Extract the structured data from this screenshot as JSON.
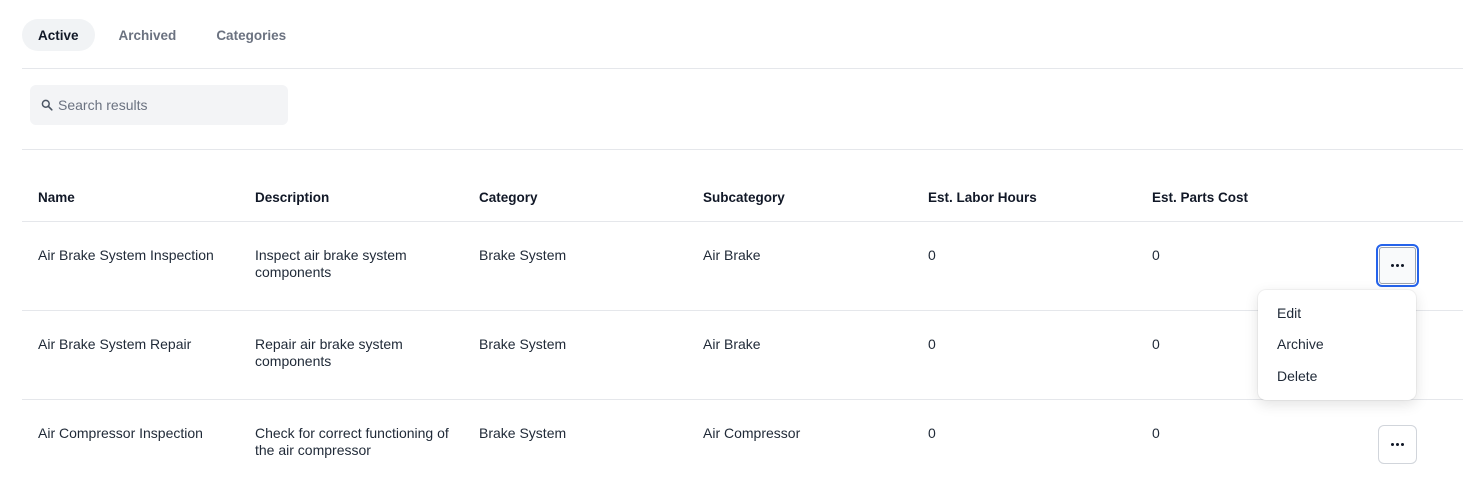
{
  "tabs": [
    {
      "label": "Active",
      "active": true
    },
    {
      "label": "Archived",
      "active": false
    },
    {
      "label": "Categories",
      "active": false
    }
  ],
  "search": {
    "placeholder": "Search results",
    "value": "",
    "icon": "search-icon"
  },
  "table": {
    "headers": {
      "name": "Name",
      "description": "Description",
      "category": "Category",
      "subcategory": "Subcategory",
      "labor_hours": "Est. Labor Hours",
      "parts_cost": "Est. Parts Cost"
    },
    "rows": [
      {
        "name": "Air Brake System Inspection",
        "description": "Inspect air brake system components",
        "category": "Brake System",
        "subcategory": "Air Brake",
        "labor_hours": "0",
        "parts_cost": "0"
      },
      {
        "name": "Air Brake System Repair",
        "description": "Repair air brake system components",
        "category": "Brake System",
        "subcategory": "Air Brake",
        "labor_hours": "0",
        "parts_cost": "0"
      },
      {
        "name": "Air Compressor Inspection",
        "description": "Check for correct functioning of the air compressor",
        "category": "Brake System",
        "subcategory": "Air Compressor",
        "labor_hours": "0",
        "parts_cost": "0"
      }
    ]
  },
  "row_menu": {
    "items": [
      "Edit",
      "Archive",
      "Delete"
    ]
  },
  "colors": {
    "focus_ring": "#2563eb",
    "active_tab_bg": "#f1f3f5",
    "search_bg": "#f3f4f6",
    "divider": "#e5e7eb"
  }
}
